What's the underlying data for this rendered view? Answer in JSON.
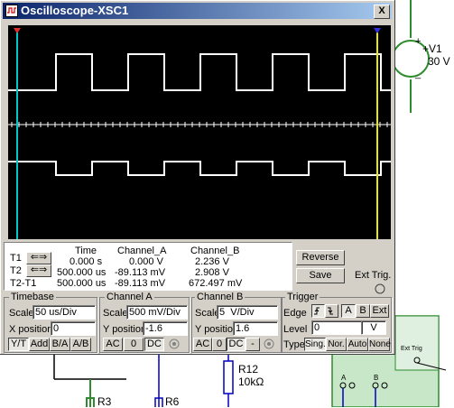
{
  "window": {
    "title": "Oscilloscope-XSC1",
    "close": "X"
  },
  "measurements": {
    "headers": [
      "Time",
      "Channel_A",
      "Channel_B"
    ],
    "rows": [
      {
        "label": "T1",
        "time": "0.000 s",
        "a": "0.000 V",
        "b": "2.236 V"
      },
      {
        "label": "T2",
        "time": "500.000 us",
        "a": "-89.113 mV",
        "b": "2.908 V"
      },
      {
        "label": "T2-T1",
        "time": "500.000 us",
        "a": "-89.113 mV",
        "b": "672.497 mV"
      }
    ]
  },
  "buttons": {
    "reverse": "Reverse",
    "save": "Save",
    "ext_trig": "Ext Trig."
  },
  "timebase": {
    "title": "Timebase",
    "scale_label": "Scale",
    "scale": "50 us/Div",
    "xpos_label": "X position",
    "xpos": "0",
    "modes": [
      "Y/T",
      "Add",
      "B/A",
      "A/B"
    ]
  },
  "channel_a": {
    "title": "Channel A",
    "scale_label": "Scale",
    "scale": "500 mV/Div",
    "ypos_label": "Y position",
    "ypos": "-1.6",
    "coupling": [
      "AC",
      "0",
      "DC"
    ]
  },
  "channel_b": {
    "title": "Channel B",
    "scale_label": "Scale",
    "scale": "5  V/Div",
    "ypos_label": "Y position",
    "ypos": "1.6",
    "coupling": [
      "AC",
      "0",
      "DC",
      "-"
    ]
  },
  "trigger": {
    "title": "Trigger",
    "edge_label": "Edge",
    "sources": [
      "A",
      "B",
      "Ext"
    ],
    "level_label": "Level",
    "level": "0",
    "level_unit": "V",
    "type_label": "Type",
    "types": [
      "Sing.",
      "Nor.",
      "Auto",
      "None"
    ]
  },
  "schematic": {
    "source_name": "+V1",
    "source_value": "30 V",
    "r12": "R12",
    "r12_value": "10kΩ",
    "r3": "R3",
    "r6": "R6",
    "ext_trig": "Ext Trig",
    "pin_a": "A",
    "pin_b": "B",
    "plus": "+",
    "minus": "_"
  },
  "colors": {
    "title_start": "#0a246a",
    "trace": "#ffffff",
    "cursor_t1": "#00c8c8",
    "cursor_t2": "#e8e800",
    "schematic_green": "#2e8b2e",
    "schematic_blue": "#0000c0",
    "instrument_fill": "#c8e6c8"
  }
}
